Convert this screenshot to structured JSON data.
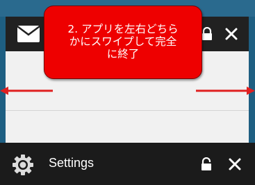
{
  "colors": {
    "accent_red": "#ee0000",
    "header_dark": "#212121",
    "bottom_bar": "#1b1b1b",
    "card_bg": "#f1f1f1",
    "background_blue": "#1e5f82"
  },
  "top_card": {
    "app_icon": "mail-icon",
    "lock_icon": "lock-icon",
    "close_icon": "close-icon"
  },
  "bottom_card": {
    "app_icon": "gear-icon",
    "label": "Settings",
    "lock_icon": "lock-icon",
    "close_icon": "close-icon"
  },
  "annotation": {
    "line1": "2. アプリを左右どちら",
    "line2": "かにスワイプして完全",
    "line3": "に終了"
  }
}
